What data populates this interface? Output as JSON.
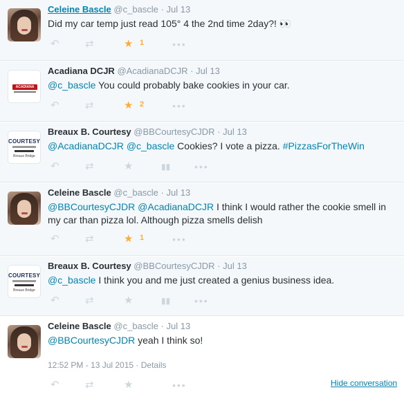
{
  "tweets": [
    {
      "name": "Celeine Bascle",
      "handle": "@c_bascle",
      "dot": "·",
      "time": "Jul 13",
      "text": "Did my car temp just read 105° 4 the 2nd time 2day?!",
      "emoji": "👀",
      "fav_count": "1"
    },
    {
      "name": "Acadiana DCJR",
      "handle": "@AcadianaDCJR",
      "dot": "·",
      "time": "Jul 13",
      "mention1": "@c_bascle",
      "text": " You could probably bake cookies in your car.",
      "fav_count": "2"
    },
    {
      "name": "Breaux B. Courtesy",
      "handle": "@BBCourtesyCJDR",
      "dot": "·",
      "time": "Jul 13",
      "mention1": "@AcadianaDCJR",
      "mention2": "@c_bascle",
      "text": " Cookies? I vote a pizza. ",
      "hashtag": "#PizzasForTheWin"
    },
    {
      "name": "Celeine Bascle",
      "handle": "@c_bascle",
      "dot": "·",
      "time": "Jul 13",
      "mention1": "@BBCourtesyCJDR",
      "mention2": "@AcadianaDCJR",
      "text": " I think I would rather the cookie smell in my car than pizza lol. Although pizza smells delish",
      "fav_count": "1"
    },
    {
      "name": "Breaux B. Courtesy",
      "handle": "@BBCourtesyCJDR",
      "dot": "·",
      "time": "Jul 13",
      "mention1": "@c_bascle",
      "text": " I think you and me just created a genius business idea."
    },
    {
      "name": "Celeine Bascle",
      "handle": "@c_bascle",
      "dot": "·",
      "time": "Jul 13",
      "mention1": "@BBCourtesyCJDR",
      "text": " yeah I think so!",
      "timestamp": "12:52 PM - 13 Jul 2015",
      "details": "Details"
    }
  ],
  "logos": {
    "acadiana": "ACADIANA",
    "courtesy": "COURTESY",
    "city": "Breaux Bridge"
  },
  "icons": {
    "reply": "reply-icon",
    "retweet": "retweet-icon",
    "favorite": "star-icon",
    "stats": "stats-icon",
    "more": "more-icon"
  },
  "glyphs": {
    "reply": "↶",
    "retweet": "⇄",
    "star": "★",
    "stats": "▮",
    "more": "•••"
  },
  "footer": {
    "hide_conversation": "Hide conversation"
  },
  "colors": {
    "link": "#0084b4",
    "favorite": "#ffac33",
    "muted": "#8899a6",
    "icon_inactive": "#ccd6dd"
  }
}
